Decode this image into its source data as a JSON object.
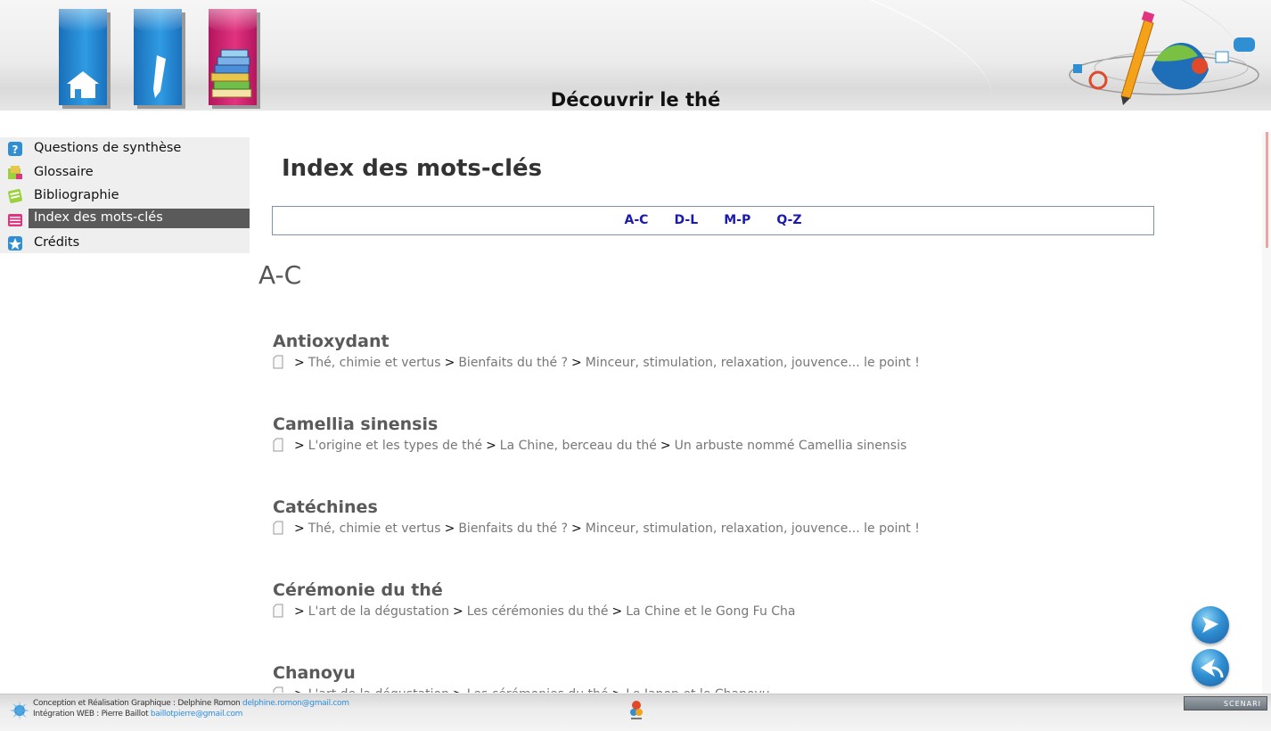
{
  "header": {
    "title": "Découvrir le thé",
    "nav_tiles": [
      {
        "name": "home",
        "icon": "home-icon"
      },
      {
        "name": "edit",
        "icon": "pencil-icon"
      },
      {
        "name": "books",
        "icon": "books-icon"
      }
    ]
  },
  "sidebar": {
    "items": [
      {
        "label": "Questions de synthèse",
        "icon": "question-icon",
        "active": false
      },
      {
        "label": "Glossaire",
        "icon": "glossary-icon",
        "active": false
      },
      {
        "label": "Bibliographie",
        "icon": "bibliography-icon",
        "active": false
      },
      {
        "label": "Index des mots-clés",
        "icon": "index-icon",
        "active": true
      },
      {
        "label": "Crédits",
        "icon": "credits-icon",
        "active": false
      }
    ]
  },
  "main": {
    "page_title": "Index des mots-clés",
    "alpha_nav": [
      "A-C",
      "D-L",
      "M-P",
      "Q-Z"
    ],
    "section_heading": "A-C",
    "entries": [
      {
        "term": "Antioxydant",
        "path": [
          "Thé, chimie et vertus",
          "Bienfaits du thé ?",
          "Minceur, stimulation, relaxation, jouvence... le point !"
        ]
      },
      {
        "term": "Camellia sinensis",
        "path": [
          "L'origine et les types de thé",
          "La Chine, berceau du thé",
          "Un arbuste nommé Camellia sinensis"
        ]
      },
      {
        "term": "Catéchines",
        "path": [
          "Thé, chimie et vertus",
          "Bienfaits du thé ?",
          "Minceur, stimulation, relaxation, jouvence... le point !"
        ]
      },
      {
        "term": "Cérémonie du thé",
        "path": [
          "L'art de la dégustation",
          "Les cérémonies du thé",
          "La Chine et le Gong Fu Cha"
        ]
      },
      {
        "term": "Chanoyu",
        "path": [
          "L'art de la dégustation",
          "Les cérémonies du thé",
          "Le Japon et le Chanoyu"
        ]
      }
    ],
    "separator": ">"
  },
  "footer": {
    "line1_prefix": "Conception et Réalisation Graphique : Delphine Romon ",
    "line1_mail": "delphine.romon@gmail.com",
    "line2_prefix": "Intégration WEB : Pierre Baillot ",
    "line2_mail": "baillotpierre@gmail.com",
    "badge": "SCENARI"
  },
  "colors": {
    "accent_link": "#1a1ab0",
    "active_item_bg": "#5a5a5a",
    "tile_blue": "#2f9be3",
    "tile_pink": "#e2337f"
  }
}
